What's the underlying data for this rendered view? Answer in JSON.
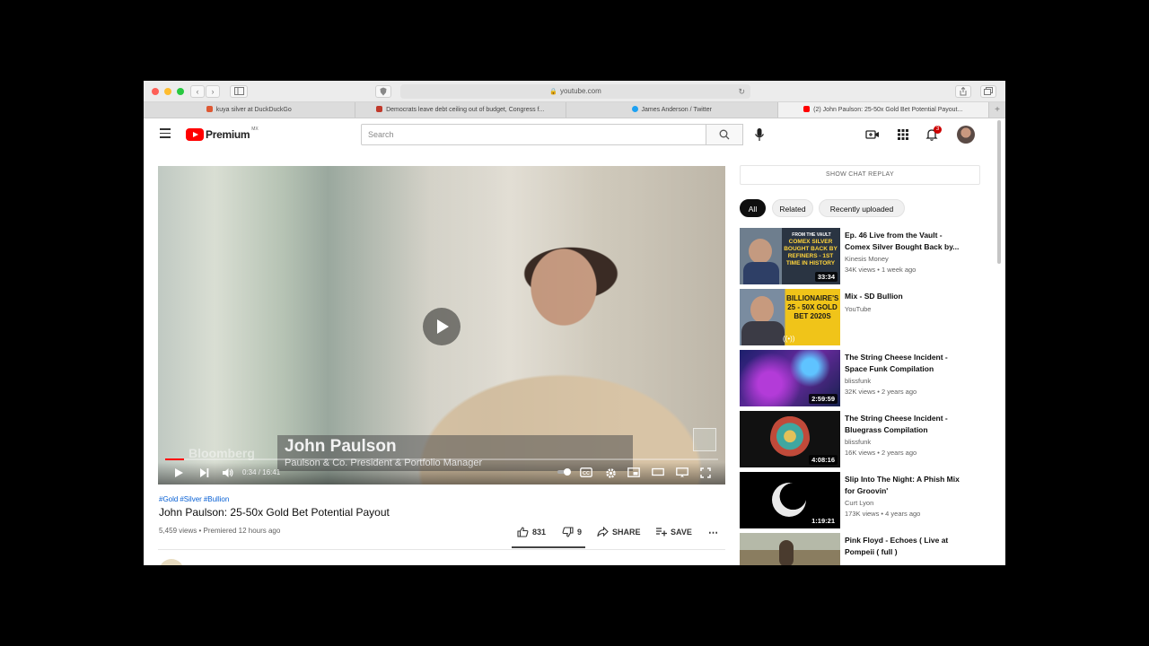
{
  "browser": {
    "url": "youtube.com",
    "tabs": [
      {
        "label": "kuya silver at DuckDuckGo",
        "color": "#de5833",
        "active": false
      },
      {
        "label": "Democrats leave debt ceiling out of budget, Congress f...",
        "color": "#c0392b",
        "active": false
      },
      {
        "label": "James Anderson / Twitter",
        "color": "#1da1f2",
        "active": false
      },
      {
        "label": "(2) John Paulson: 25-50x Gold Bet Potential Payout...",
        "color": "#ff0000",
        "active": true
      }
    ]
  },
  "header": {
    "logo_text": "Premium",
    "logo_region": "MX",
    "search_placeholder": "Search",
    "notification_count": "3"
  },
  "player": {
    "lower_third_name": "John Paulson",
    "lower_third_title": "Paulson & Co. President & Portfolio Manager",
    "watermark": "Bloomberg",
    "current_time": "0:34",
    "duration": "16:41",
    "time_display": "0:34 / 16:41",
    "progress_fraction": 0.034
  },
  "video": {
    "hashtags": [
      "#Gold",
      "#Silver",
      "#Bullion"
    ],
    "title": "John Paulson: 25-50x Gold Bet Potential Payout",
    "meta": "5,459 views • Premiered 12 hours ago",
    "likes": "831",
    "dislikes": "9",
    "share_label": "SHARE",
    "save_label": "SAVE"
  },
  "sidebar": {
    "chat_replay_label": "SHOW CHAT REPLAY",
    "chips": [
      "All",
      "Related",
      "Recently uploaded"
    ],
    "recommendations": [
      {
        "title": "Ep. 46 Live from the Vault - Comex Silver Bought Back by...",
        "channel": "Kinesis Money",
        "meta": "34K views • 1 week ago",
        "duration": "33:34"
      },
      {
        "title": "Mix - SD Bullion",
        "channel": "YouTube",
        "meta": "",
        "duration": ""
      },
      {
        "title": "The String Cheese Incident - Space Funk Compilation",
        "channel": "blissfunk",
        "meta": "32K views • 2 years ago",
        "duration": "2:59:59"
      },
      {
        "title": "The String Cheese Incident - Bluegrass Compilation",
        "channel": "blissfunk",
        "meta": "16K views • 2 years ago",
        "duration": "4:08:16"
      },
      {
        "title": "Slip Into The Night: A Phish Mix for Groovin'",
        "channel": "Curt Lyon",
        "meta": "173K views • 4 years ago",
        "duration": "1:19:21"
      },
      {
        "title": "Pink Floyd - Echoes ( Live at Pompeii ( full )",
        "channel": "",
        "meta": "",
        "duration": ""
      }
    ],
    "thumb_text": {
      "comex_tag": "FROM THE VAULT",
      "comex": "COMEX SILVER BOUGHT BACK BY REFINERS - 1ST TIME IN HISTORY",
      "billionaire": "BILLIONAIRE'S 25 - 50X GOLD BET 2020S"
    }
  },
  "colors": {
    "youtube_red": "#ff0000",
    "link_blue": "#065fd4",
    "text_primary": "#0f0f0f",
    "text_secondary": "#606060"
  }
}
